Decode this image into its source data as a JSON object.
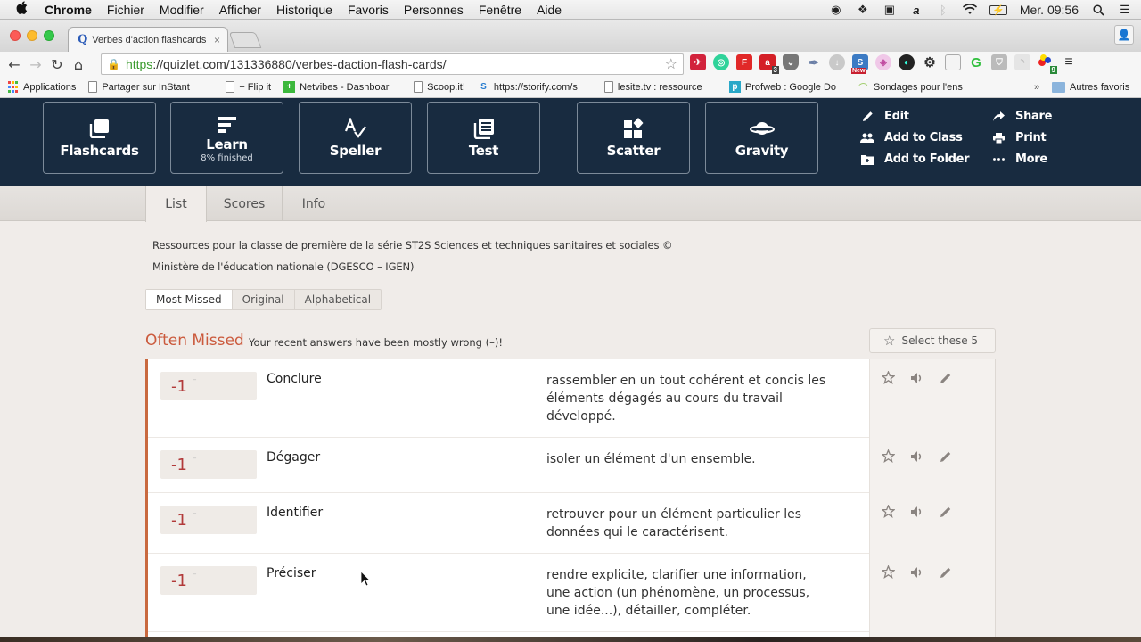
{
  "menubar": {
    "apple": "",
    "items": [
      "Chrome",
      "Fichier",
      "Modifier",
      "Afficher",
      "Historique",
      "Favoris",
      "Personnes",
      "Fenêtre",
      "Aide"
    ],
    "clock": "Mer. 09:56"
  },
  "browser": {
    "tab_title": "Verbes d'action flashcards",
    "tab_close": "×",
    "url_scheme": "https",
    "url_rest": "://quizlet.com/131336880/verbes-daction-flash-cards/",
    "extension_badges": {
      "avira": "3",
      "new": "New",
      "multi": "9"
    },
    "bookmarks": [
      {
        "label": "Applications",
        "icon": "apps-grid-icon"
      },
      {
        "label": "Partager sur InStant",
        "icon": "page-icon"
      },
      {
        "label": "+ Flip it",
        "icon": "page-icon"
      },
      {
        "label": "Netvibes - Dashboar",
        "icon": "netvibes-icon"
      },
      {
        "label": "Scoop.it!",
        "icon": "page-icon"
      },
      {
        "label": "https://storify.com/s",
        "icon": "storify-icon"
      },
      {
        "label": "lesite.tv : ressource",
        "icon": "page-icon"
      },
      {
        "label": "Profweb : Google Do",
        "icon": "profweb-icon"
      },
      {
        "label": "Sondages pour l'ens",
        "icon": "sondages-icon"
      }
    ],
    "bookmarks_overflow": "»",
    "other_bookmarks": "Autres favoris"
  },
  "study_modes": [
    {
      "label": "Flashcards",
      "sub": "",
      "icon": "flashcards-icon"
    },
    {
      "label": "Learn",
      "sub": "8% finished",
      "icon": "learn-icon"
    },
    {
      "label": "Speller",
      "sub": "",
      "icon": "speller-icon"
    },
    {
      "label": "Test",
      "sub": "",
      "icon": "test-icon"
    },
    {
      "label": "Scatter",
      "sub": "",
      "icon": "scatter-icon"
    },
    {
      "label": "Gravity",
      "sub": "",
      "icon": "gravity-icon"
    }
  ],
  "learn_progress_percent": 8,
  "actions_left": [
    {
      "label": "Edit",
      "icon": "pencil-icon"
    },
    {
      "label": "Add to Class",
      "icon": "people-icon"
    },
    {
      "label": "Add to Folder",
      "icon": "folder-add-icon"
    }
  ],
  "actions_right": [
    {
      "label": "Share",
      "icon": "share-icon"
    },
    {
      "label": "Print",
      "icon": "print-icon"
    },
    {
      "label": "More",
      "icon": "more-icon"
    }
  ],
  "tabs": [
    "List",
    "Scores",
    "Info"
  ],
  "active_tab": "List",
  "description": [
    "Ressources pour la classe de première de la série ST2S Sciences et techniques sanitaires et sociales ©",
    "Ministère de l'éducation nationale (DGESCO – IGEN)"
  ],
  "sort_options": [
    "Most Missed",
    "Original",
    "Alphabetical"
  ],
  "active_sort": "Most Missed",
  "section": {
    "title": "Often Missed",
    "subtitle": "Your recent answers have been mostly wrong (–)!",
    "select_button": "Select these 5"
  },
  "cards": [
    {
      "score": "-1",
      "score_detail": "–",
      "term": "Conclure",
      "definition": "rassembler en un tout cohérent et concis les éléments dégagés au cours du travail développé."
    },
    {
      "score": "-1",
      "score_detail": "–",
      "term": "Dégager",
      "definition": "isoler un élément d'un ensemble."
    },
    {
      "score": "-1",
      "score_detail": "–",
      "term": "Identifier",
      "definition": "retrouver pour un élément particulier les données qui le caractérisent."
    },
    {
      "score": "-1",
      "score_detail": "–",
      "term": "Préciser",
      "definition": "rendre explicite, clarifier une information, une action (un phénomène, un processus, une idée...), détailler, compléter."
    }
  ],
  "colors": {
    "header_bg": "#182b40",
    "accent_missed": "#cb5a3d",
    "score_red": "#b23a3a",
    "page_bg": "#f0ece9"
  }
}
